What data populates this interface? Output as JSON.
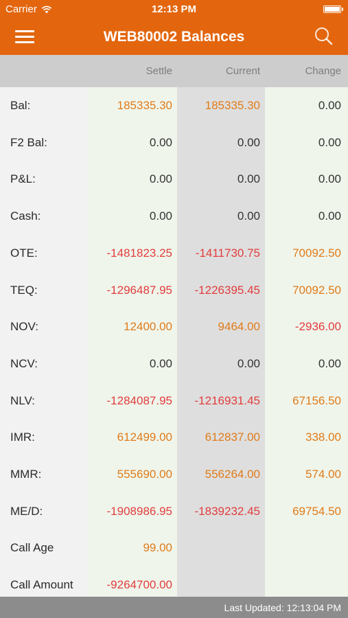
{
  "status_bar": {
    "carrier": "Carrier",
    "time": "12:13 PM"
  },
  "navbar": {
    "title": "WEB80002 Balances"
  },
  "columns": {
    "settle": "Settle",
    "current": "Current",
    "change": "Change"
  },
  "colors": {
    "brand": "#E3660E",
    "positive": "#E07B1A",
    "negative": "#E23C3C",
    "neutral": "#333333"
  },
  "rows": [
    {
      "label": "Bal:",
      "settle": "185335.30",
      "settle_tone": "positive",
      "current": "185335.30",
      "current_tone": "positive",
      "change": "0.00",
      "change_tone": "neutral"
    },
    {
      "label": "F2 Bal:",
      "settle": "0.00",
      "settle_tone": "neutral",
      "current": "0.00",
      "current_tone": "neutral",
      "change": "0.00",
      "change_tone": "neutral"
    },
    {
      "label": "P&L:",
      "settle": "0.00",
      "settle_tone": "neutral",
      "current": "0.00",
      "current_tone": "neutral",
      "change": "0.00",
      "change_tone": "neutral"
    },
    {
      "label": "Cash:",
      "settle": "0.00",
      "settle_tone": "neutral",
      "current": "0.00",
      "current_tone": "neutral",
      "change": "0.00",
      "change_tone": "neutral"
    },
    {
      "label": "OTE:",
      "settle": "-1481823.25",
      "settle_tone": "negative",
      "current": "-1411730.75",
      "current_tone": "negative",
      "change": "70092.50",
      "change_tone": "positive"
    },
    {
      "label": "TEQ:",
      "settle": "-1296487.95",
      "settle_tone": "negative",
      "current": "-1226395.45",
      "current_tone": "negative",
      "change": "70092.50",
      "change_tone": "positive"
    },
    {
      "label": "NOV:",
      "settle": "12400.00",
      "settle_tone": "positive",
      "current": "9464.00",
      "current_tone": "positive",
      "change": "-2936.00",
      "change_tone": "negative"
    },
    {
      "label": "NCV:",
      "settle": "0.00",
      "settle_tone": "neutral",
      "current": "0.00",
      "current_tone": "neutral",
      "change": "0.00",
      "change_tone": "neutral"
    },
    {
      "label": "NLV:",
      "settle": "-1284087.95",
      "settle_tone": "negative",
      "current": "-1216931.45",
      "current_tone": "negative",
      "change": "67156.50",
      "change_tone": "positive"
    },
    {
      "label": "IMR:",
      "settle": "612499.00",
      "settle_tone": "positive",
      "current": "612837.00",
      "current_tone": "positive",
      "change": "338.00",
      "change_tone": "positive"
    },
    {
      "label": "MMR:",
      "settle": "555690.00",
      "settle_tone": "positive",
      "current": "556264.00",
      "current_tone": "positive",
      "change": "574.00",
      "change_tone": "positive"
    },
    {
      "label": "ME/D:",
      "settle": "-1908986.95",
      "settle_tone": "negative",
      "current": "-1839232.45",
      "current_tone": "negative",
      "change": "69754.50",
      "change_tone": "positive"
    },
    {
      "label": "Call Age",
      "settle": "99.00",
      "settle_tone": "positive",
      "current": "",
      "current_tone": "neutral",
      "change": "",
      "change_tone": "neutral"
    },
    {
      "label": "Call Amount",
      "settle": "-9264700.00",
      "settle_tone": "negative",
      "current": "",
      "current_tone": "neutral",
      "change": "",
      "change_tone": "neutral"
    }
  ],
  "footer": {
    "last_updated": "Last Updated: 12:13:04 PM"
  },
  "icons": {
    "menu": "hamburger-icon",
    "search": "search-icon",
    "wifi": "wifi-icon",
    "battery": "battery-icon"
  }
}
